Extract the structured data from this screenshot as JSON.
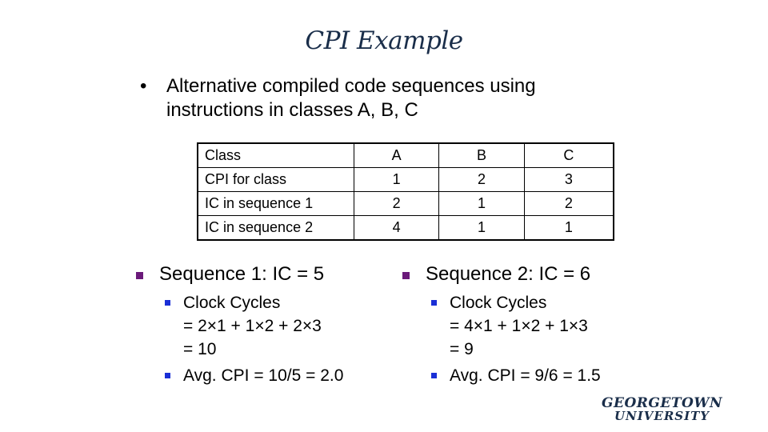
{
  "slide": {
    "title": "CPI Example",
    "intro_bullet": "•",
    "intro_text": "Alternative compiled code sequences using instructions in classes A, B, C"
  },
  "table": {
    "header": [
      "Class",
      "A",
      "B",
      "C"
    ],
    "rows": [
      [
        "CPI for class",
        "1",
        "2",
        "3"
      ],
      [
        "IC in sequence 1",
        "2",
        "1",
        "2"
      ],
      [
        "IC in sequence 2",
        "4",
        "1",
        "1"
      ]
    ]
  },
  "sequence1": {
    "heading": "Sequence 1: IC = 5",
    "clock_cycles_lines": [
      "Clock Cycles",
      "= 2×1 + 1×2 + 2×3",
      "= 10"
    ],
    "avg_cpi": "Avg. CPI = 10/5 = 2.0"
  },
  "sequence2": {
    "heading": "Sequence 2: IC = 6",
    "clock_cycles_lines": [
      "Clock Cycles",
      "= 4×1 + 1×2 + 1×3",
      "= 9"
    ],
    "avg_cpi": "Avg. CPI = 9/6 = 1.5"
  },
  "logo": {
    "line1": "GEORGETOWN",
    "line2": "UNIVERSITY"
  },
  "colors": {
    "title": "#1a2e4a",
    "level1_bullet": "#6b1a7a",
    "level2_bullet": "#1a2fd6"
  }
}
